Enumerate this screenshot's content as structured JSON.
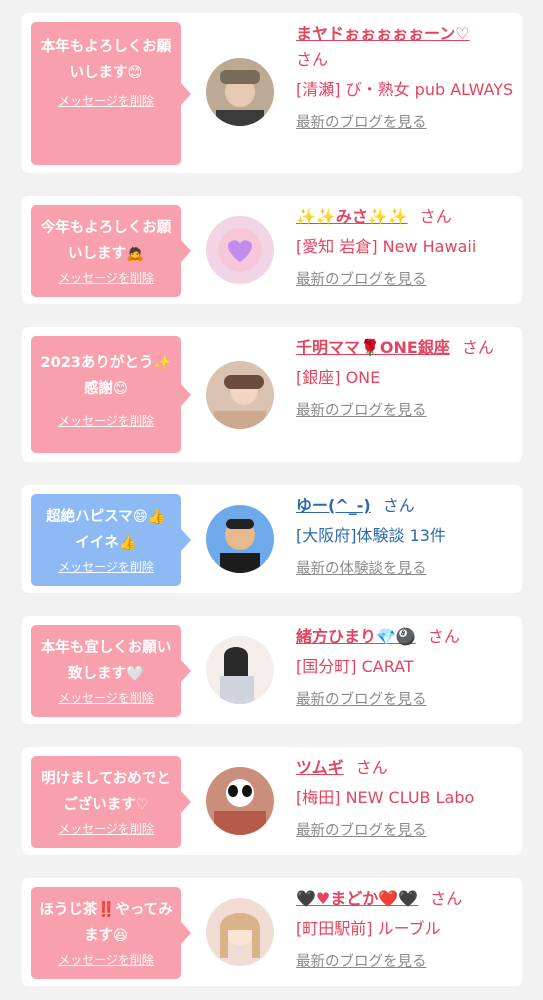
{
  "cards": [
    {
      "message": "本年もよろしくお願いします😊",
      "delete_label": "メッセージを削除",
      "name": "まヤドぉぉぉぉぉーン♡",
      "honorific": "さん",
      "shop": "[清瀬] び・熟女 pub ALWAYS",
      "link": "最新のブログを見る"
    },
    {
      "message": "今年もよろしくお願いします🙇",
      "delete_label": "メッセージを削除",
      "name": "✨✨みさ✨✨",
      "honorific": "さん",
      "shop": "[愛知 岩倉] New Hawaii",
      "link": "最新のブログを見る"
    },
    {
      "message": "2023ありがとう✨感謝😊",
      "delete_label": "メッセージを削除",
      "name": "千明ママ🌹ONE銀座",
      "honorific": "さん",
      "shop": "[銀座] ONE",
      "link": "最新のブログを見る"
    },
    {
      "message": "超絶ハピスマ😄👍イイネ👍",
      "delete_label": "メッセージを削除",
      "name": "ゆー(^_-)",
      "honorific": "さん",
      "shop": "[大阪府]体験談 13件",
      "link": "最新の体験談を見る"
    },
    {
      "message": "本年も宜しくお願い致します🤍",
      "delete_label": "メッセージを削除",
      "name": "緒方ひまり💎🎱",
      "honorific": "さん",
      "shop": "[国分町] CARAT",
      "link": "最新のブログを見る"
    },
    {
      "message": "明けましておめでとございます♡",
      "delete_label": "メッセージを削除",
      "name": "ツムギ",
      "honorific": "さん",
      "shop": "[梅田] NEW CLUB Labo",
      "link": "最新のブログを見る"
    },
    {
      "message": "ほうじ茶‼️やってみます😆",
      "delete_label": "メッセージを削除",
      "name": "🖤♥まどか❤️🖤",
      "honorific": "さん",
      "shop": "[町田駅前] ルーブル",
      "link": "最新のブログを見る"
    }
  ]
}
